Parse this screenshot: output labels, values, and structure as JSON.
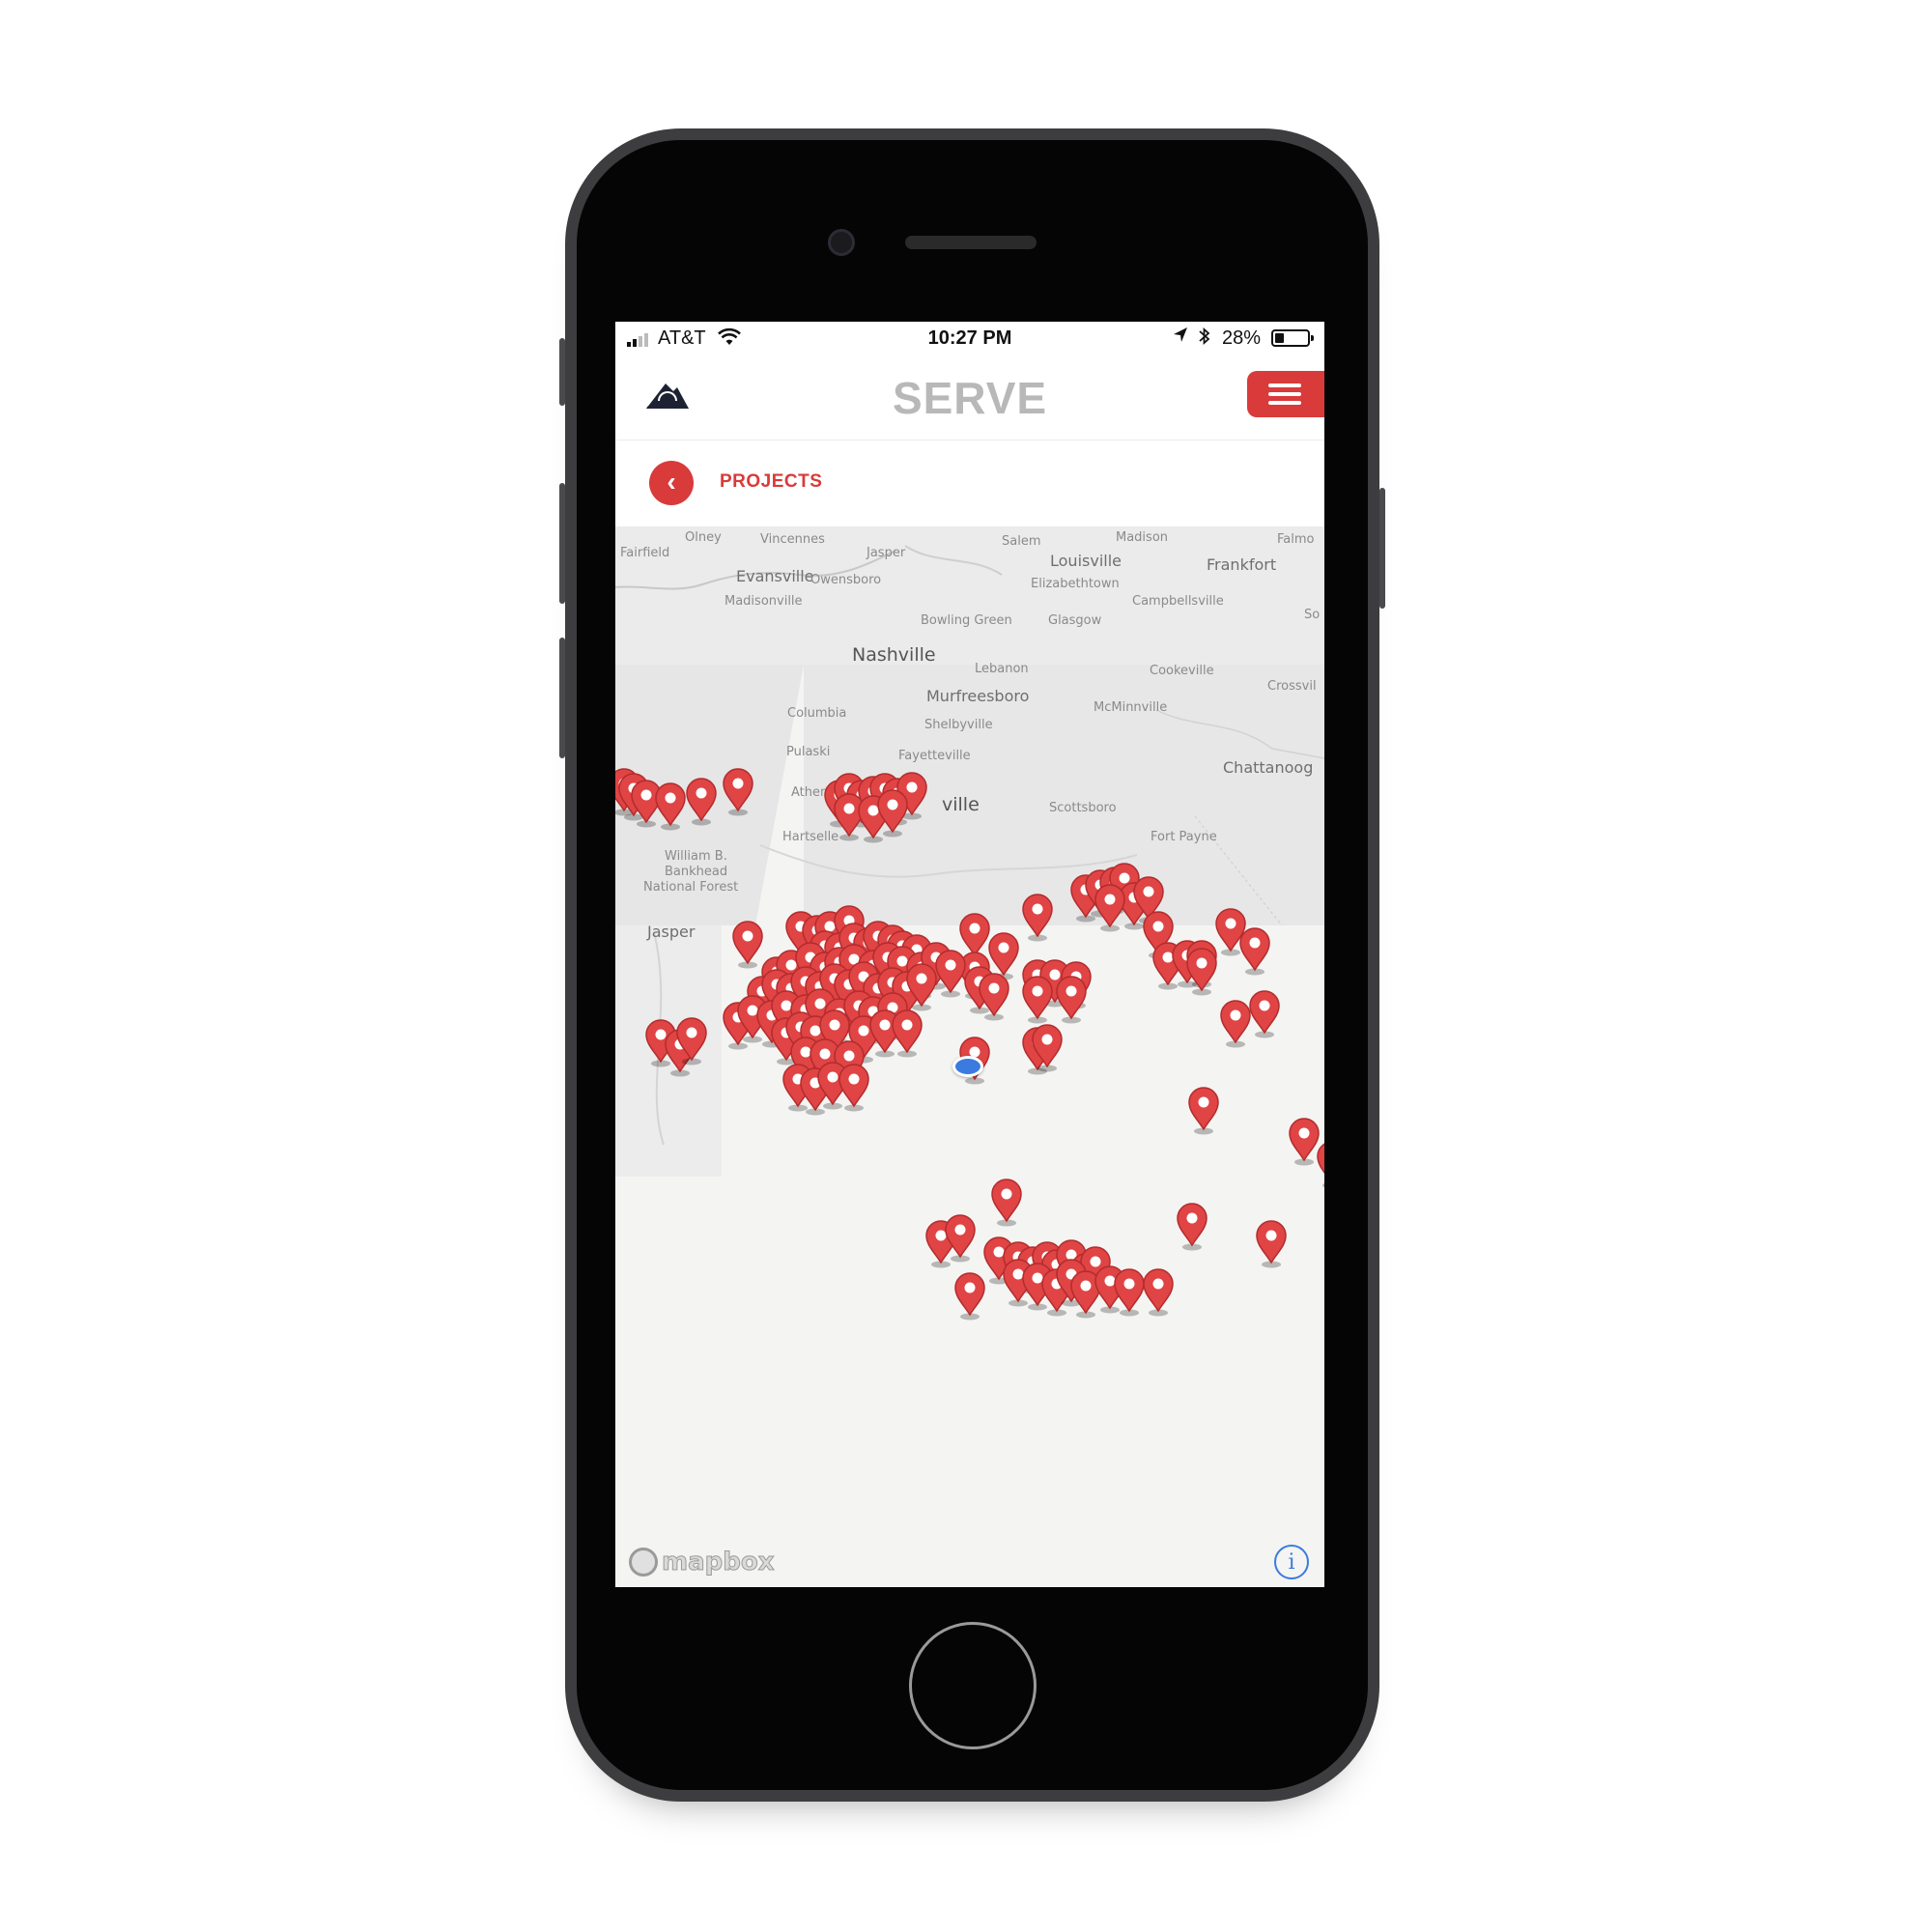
{
  "status_bar": {
    "carrier": "AT&T",
    "time": "10:27 PM",
    "battery_percent": "28%",
    "battery_level": 0.28,
    "icons": [
      "signal-icon",
      "wifi-icon",
      "location-arrow-icon",
      "bluetooth-icon",
      "battery-icon"
    ]
  },
  "app_bar": {
    "title": "SERVE",
    "logo": "mountain-sun-logo",
    "menu_icon": "hamburger-menu-icon",
    "accent_color": "#d93a3a"
  },
  "sub_bar": {
    "back_icon": "chevron-left-icon",
    "title": "PROJECTS"
  },
  "map": {
    "places": [
      "Olney",
      "Vincennes",
      "Jasper",
      "Salem",
      "Madison",
      "Falmo",
      "Fairfield",
      "Louisville",
      "Frankfort",
      "Evansville",
      "Owensboro",
      "Elizabethtown",
      "Madisonville",
      "Campbellsville",
      "Bowling Green",
      "Glasgow",
      "So",
      "Nashville",
      "Lebanon",
      "Cookeville",
      "Crossvil",
      "Murfreesboro",
      "McMinnville",
      "Columbia",
      "Shelbyville",
      "Pulaski",
      "Fayetteville",
      "Chattanoog",
      "Athens",
      "ville",
      "Scottsboro",
      "Hartselle",
      "Fort Payne",
      "William B.",
      "Bankhead",
      "National Forest",
      "Jasper"
    ],
    "attribution": "mapbox",
    "info_icon": "info-icon",
    "pin_icon": "map-pin-icon",
    "user_location_icon": "user-location-dot-icon",
    "pin_color": "#e04444",
    "user_dot_color": "#3b7be0"
  }
}
